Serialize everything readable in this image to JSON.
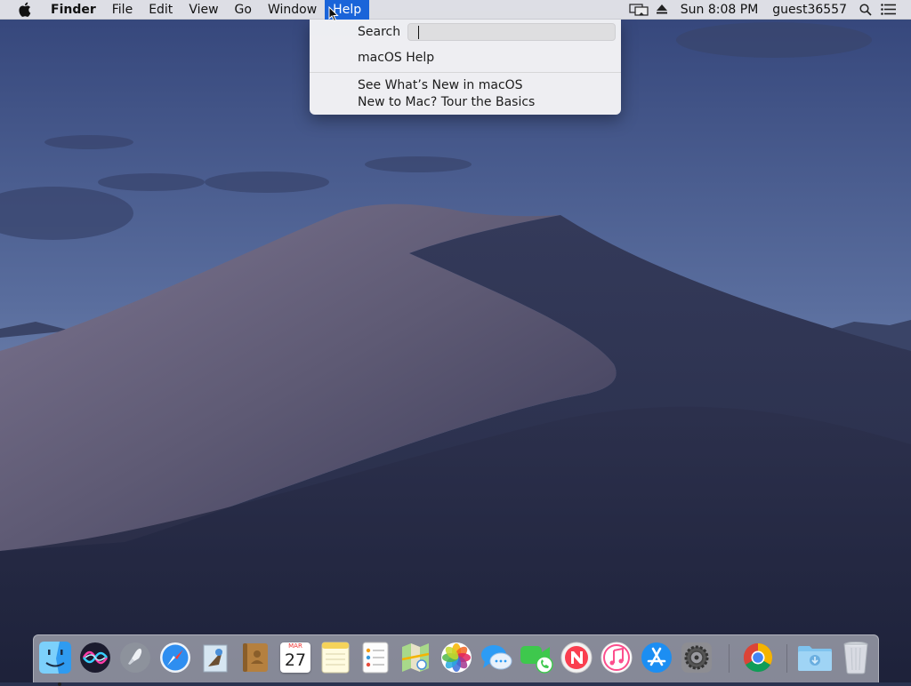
{
  "menubar": {
    "app_name": "Finder",
    "menus": [
      "File",
      "Edit",
      "View",
      "Go",
      "Window",
      "Help"
    ],
    "active_menu": "Help",
    "clock": "Sun 8:08 PM",
    "user": "guest36557",
    "status_icons": [
      "display-mirroring-icon",
      "eject-icon",
      "spotlight-icon",
      "notification-center-icon"
    ]
  },
  "help_menu": {
    "search_label": "Search",
    "search_value": "",
    "items": [
      "macOS Help",
      "See What’s New in macOS",
      "New to Mac? Tour the Basics"
    ]
  },
  "dock": {
    "calendar": {
      "month": "MAR",
      "day": "27"
    },
    "apps": [
      "Finder",
      "Siri",
      "Launchpad",
      "Safari",
      "Mail",
      "Contacts",
      "Calendar",
      "Notes",
      "Reminders",
      "Maps",
      "Photos",
      "Messages",
      "FaceTime",
      "News",
      "iTunes",
      "App Store",
      "System Preferences",
      "Google Chrome",
      "Downloads",
      "Trash"
    ]
  },
  "colors": {
    "menu_highlight": "#1a64d9",
    "sky_top": "#3c4d7e",
    "sky_bottom": "#6a7fac",
    "dune_light": "#6f6a82",
    "dune_dark": "#2a2f4c"
  }
}
